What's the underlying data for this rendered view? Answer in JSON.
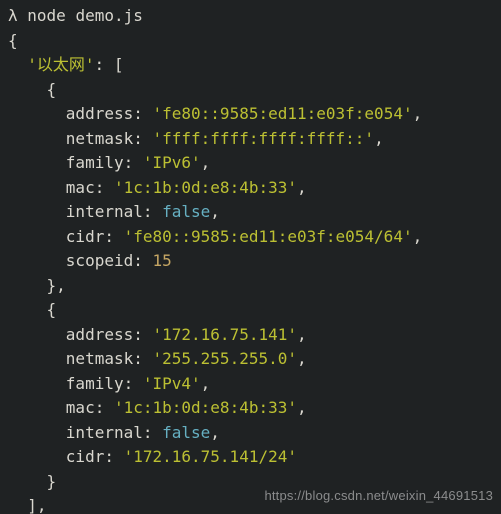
{
  "prompt": {
    "symbol": "λ",
    "command": "node demo.js"
  },
  "output": {
    "open": "{",
    "iface_key": "'以太网'",
    "colon_bracket": ": [",
    "entries": [
      {
        "open": "{",
        "fields": [
          {
            "k": "address",
            "v": "'fe80::9585:ed11:e03f:e054'",
            "t": "str",
            "trail": ","
          },
          {
            "k": "netmask",
            "v": "'ffff:ffff:ffff:ffff::'",
            "t": "str",
            "trail": ","
          },
          {
            "k": "family",
            "v": "'IPv6'",
            "t": "str",
            "trail": ","
          },
          {
            "k": "mac",
            "v": "'1c:1b:0d:e8:4b:33'",
            "t": "str",
            "trail": ","
          },
          {
            "k": "internal",
            "v": "false",
            "t": "kw",
            "trail": ","
          },
          {
            "k": "cidr",
            "v": "'fe80::9585:ed11:e03f:e054/64'",
            "t": "str",
            "trail": ","
          },
          {
            "k": "scopeid",
            "v": "15",
            "t": "num",
            "trail": ""
          }
        ],
        "close": "},"
      },
      {
        "open": "{",
        "fields": [
          {
            "k": "address",
            "v": "'172.16.75.141'",
            "t": "str",
            "trail": ","
          },
          {
            "k": "netmask",
            "v": "'255.255.255.0'",
            "t": "str",
            "trail": ","
          },
          {
            "k": "family",
            "v": "'IPv4'",
            "t": "str",
            "trail": ","
          },
          {
            "k": "mac",
            "v": "'1c:1b:0d:e8:4b:33'",
            "t": "str",
            "trail": ","
          },
          {
            "k": "internal",
            "v": "false",
            "t": "kw",
            "trail": ","
          },
          {
            "k": "cidr",
            "v": "'172.16.75.141/24'",
            "t": "str",
            "trail": ""
          }
        ],
        "close": "}"
      }
    ],
    "close_array": "],"
  },
  "watermark": "https://blog.csdn.net/weixin_44691513"
}
